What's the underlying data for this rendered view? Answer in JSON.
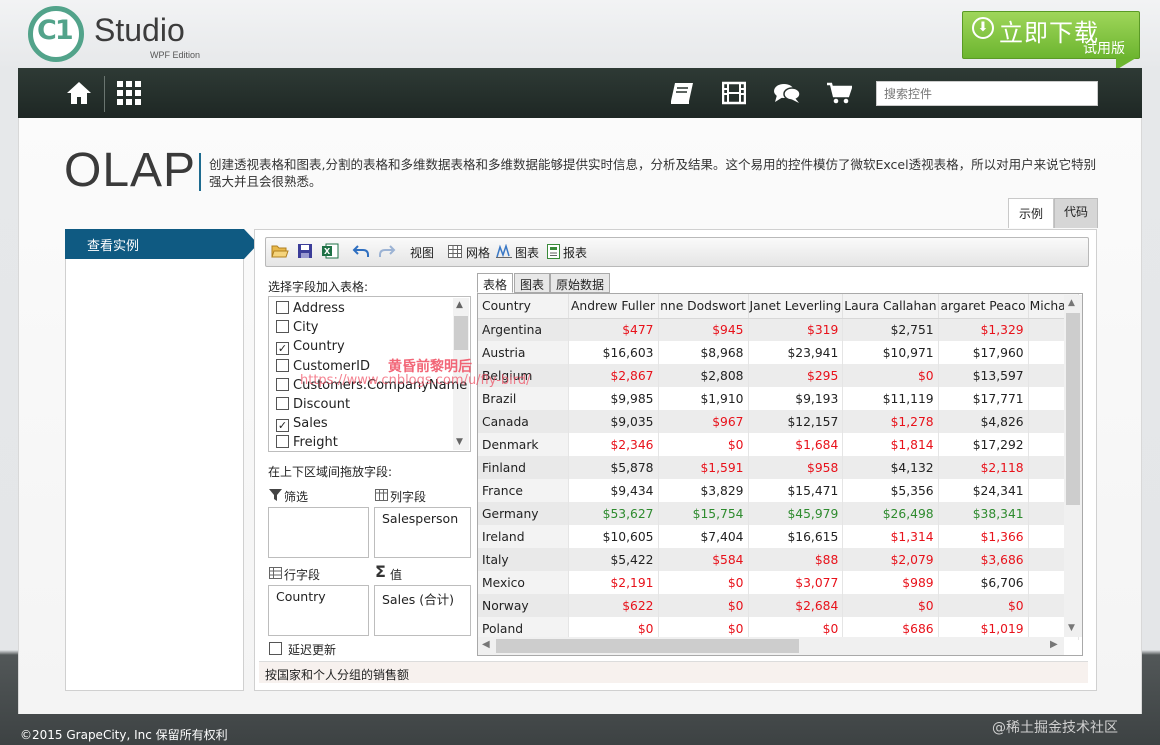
{
  "brand": {
    "logo_mark": "C1",
    "name": "Studio",
    "edition": "WPF Edition",
    "accent": "#52a38a"
  },
  "download": {
    "label": "立即下载",
    "sub": "试用版",
    "icon": "download-arrow-icon"
  },
  "nav": {
    "icons": [
      "home-icon",
      "grid-menu-icon",
      "book-icon",
      "film-icon",
      "chat-icon",
      "cart-icon"
    ],
    "search_placeholder": "搜索控件"
  },
  "page": {
    "title": "OLAP",
    "description": "创建透视表格和图表,分割的表格和多维数据表格和多维数据能够提供实时信息，分析及结果。这个易用的控件模仿了微软Excel透视表格，所以对用户来说它特别强大并且会很熟悉。",
    "tabs": [
      "示例",
      "代码"
    ]
  },
  "sidebar": {
    "items": [
      "查看实例"
    ]
  },
  "toolbar": {
    "view": "视图",
    "grid": "网格",
    "chart": "图表",
    "report": "报表"
  },
  "fields": {
    "title": "选择字段加入表格:",
    "items": [
      {
        "label": "Address",
        "checked": false
      },
      {
        "label": "City",
        "checked": false
      },
      {
        "label": "Country",
        "checked": true
      },
      {
        "label": "CustomerID",
        "checked": false
      },
      {
        "label": "Customers.CompanyName",
        "checked": false
      },
      {
        "label": "Discount",
        "checked": false
      },
      {
        "label": "Sales",
        "checked": true
      },
      {
        "label": "Freight",
        "checked": false
      }
    ],
    "drag_hint": "在上下区域间拖放字段:",
    "filter_label": "筛选",
    "column_label": "列字段",
    "row_label": "行字段",
    "value_label": "值",
    "column_value": "Salesperson",
    "row_value": "Country",
    "values_value": "Sales (合计)",
    "defer_label": "延迟更新"
  },
  "grid": {
    "tabs": [
      "表格",
      "图表",
      "原始数据"
    ],
    "headers": [
      "Country",
      "Andrew Fuller",
      "nne Dodswort",
      "Janet Leverling",
      "Laura Callahan",
      "argaret Peaco",
      "Michael"
    ],
    "rows": [
      [
        "Argentina",
        "$477",
        "$945",
        "$319",
        "$2,751",
        "$1,329"
      ],
      [
        "Austria",
        "$16,603",
        "$8,968",
        "$23,941",
        "$10,971",
        "$17,960"
      ],
      [
        "Belgium",
        "$2,867",
        "$2,808",
        "$295",
        "$0",
        "$13,597"
      ],
      [
        "Brazil",
        "$9,985",
        "$1,910",
        "$9,193",
        "$11,119",
        "$17,771"
      ],
      [
        "Canada",
        "$9,035",
        "$967",
        "$12,157",
        "$1,278",
        "$4,826"
      ],
      [
        "Denmark",
        "$2,346",
        "$0",
        "$1,684",
        "$1,814",
        "$17,292"
      ],
      [
        "Finland",
        "$5,878",
        "$1,591",
        "$958",
        "$4,132",
        "$2,118"
      ],
      [
        "France",
        "$9,434",
        "$3,829",
        "$15,471",
        "$5,356",
        "$24,341"
      ],
      [
        "Germany",
        "$53,627",
        "$15,754",
        "$45,979",
        "$26,498",
        "$38,341"
      ],
      [
        "Ireland",
        "$10,605",
        "$7,404",
        "$16,615",
        "$1,314",
        "$1,366"
      ],
      [
        "Italy",
        "$5,422",
        "$584",
        "$88",
        "$2,079",
        "$3,686"
      ],
      [
        "Mexico",
        "$2,191",
        "$0",
        "$3,077",
        "$989",
        "$6,706"
      ],
      [
        "Norway",
        "$622",
        "$0",
        "$2,684",
        "$0",
        "$0"
      ],
      [
        "Poland",
        "$0",
        "$0",
        "$0",
        "$686",
        "$1,019"
      ]
    ],
    "colors": [
      [
        "red",
        "red",
        "red",
        "black",
        "red"
      ],
      [
        "black",
        "black",
        "black",
        "black",
        "black"
      ],
      [
        "red",
        "black",
        "red",
        "red",
        "black"
      ],
      [
        "black",
        "black",
        "black",
        "black",
        "black"
      ],
      [
        "black",
        "red",
        "black",
        "red",
        "black"
      ],
      [
        "red",
        "red",
        "red",
        "red",
        "black"
      ],
      [
        "black",
        "red",
        "red",
        "black",
        "red"
      ],
      [
        "black",
        "black",
        "black",
        "black",
        "black"
      ],
      [
        "green",
        "green",
        "green",
        "green",
        "green"
      ],
      [
        "black",
        "black",
        "black",
        "red",
        "red"
      ],
      [
        "black",
        "red",
        "red",
        "red",
        "red"
      ],
      [
        "red",
        "red",
        "red",
        "red",
        "black"
      ],
      [
        "red",
        "red",
        "red",
        "red",
        "red"
      ],
      [
        "red",
        "red",
        "red",
        "red",
        "red"
      ]
    ]
  },
  "status": "按国家和个人分组的销售额",
  "watermark": {
    "line1": "黄昏前黎明后",
    "line2": "https://www.cnblogs.com/u/fly-bird/"
  },
  "footer": {
    "copyright": "©2015 GrapeCity, Inc 保留所有权利",
    "community": "@稀土掘金技术社区"
  }
}
